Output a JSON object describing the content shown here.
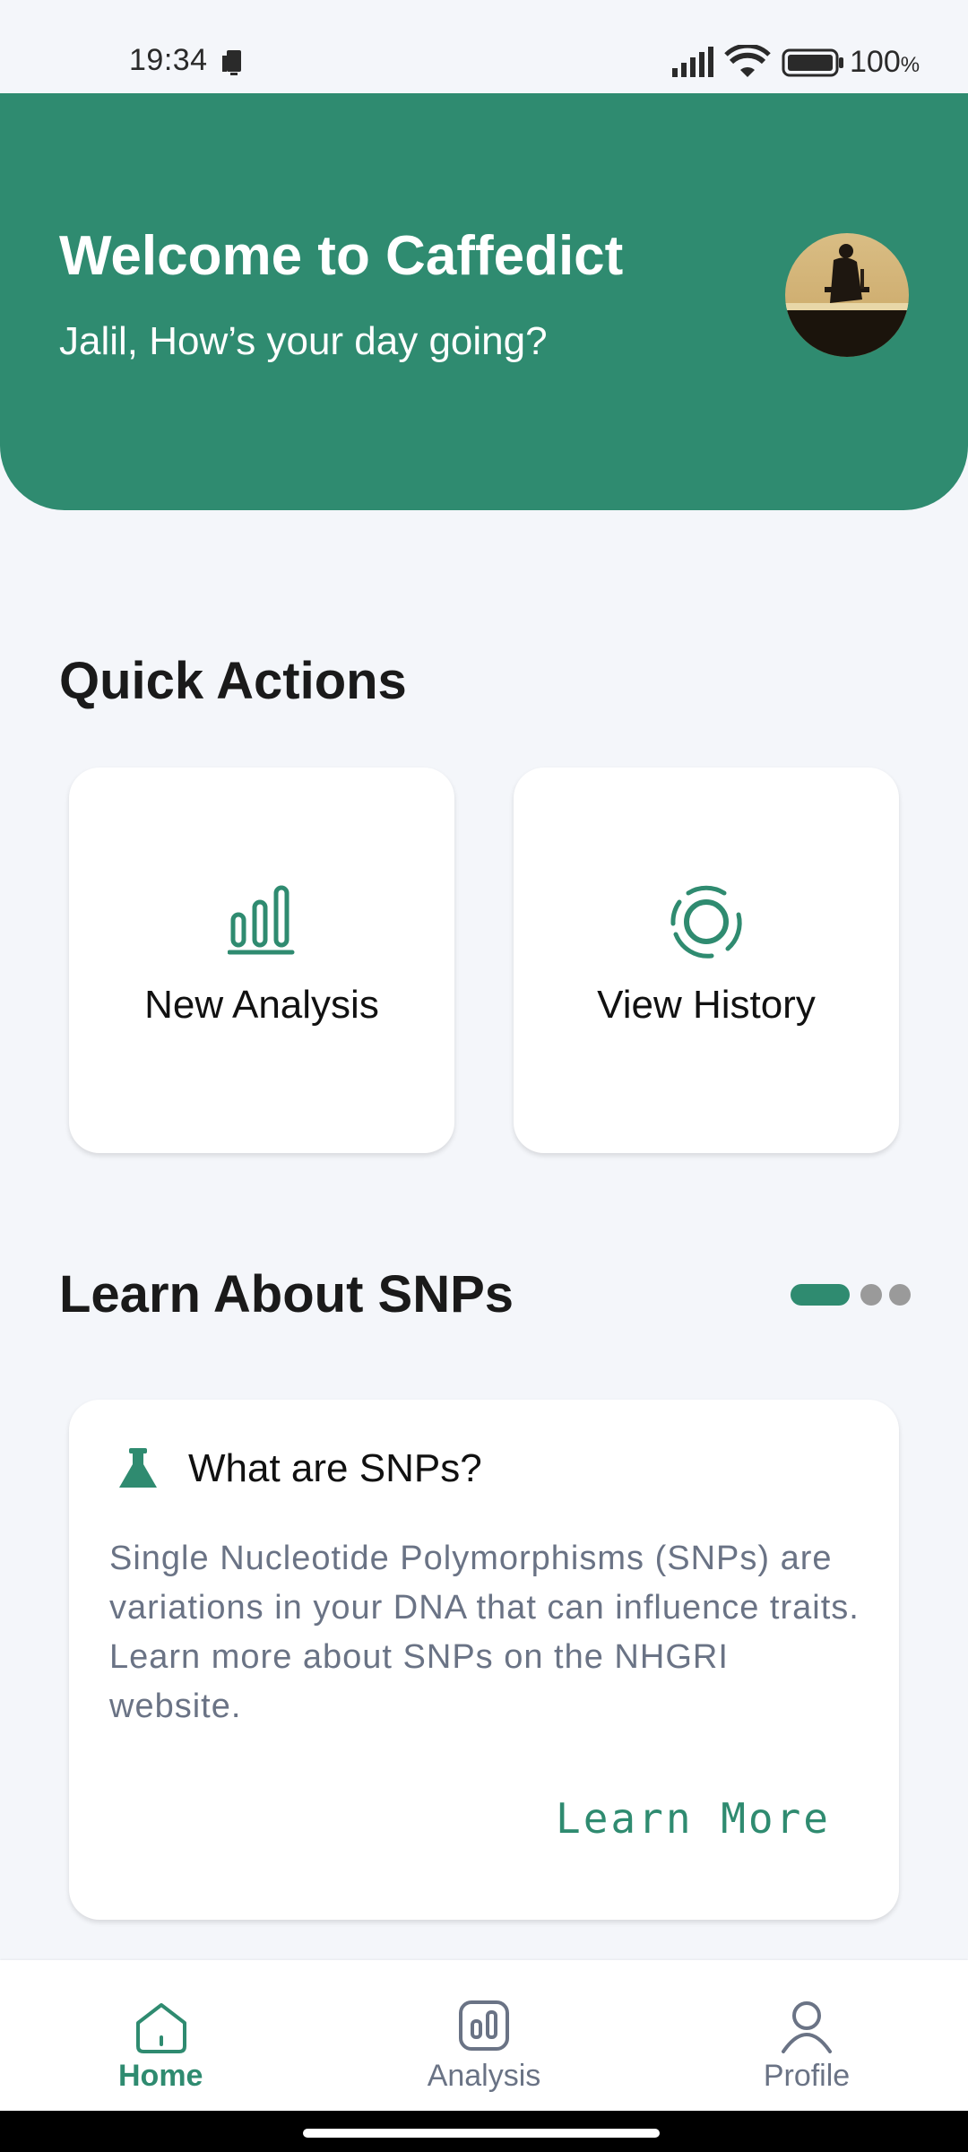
{
  "status_bar": {
    "time": "19:34",
    "battery": "100",
    "battery_unit": "%"
  },
  "header": {
    "title": "Welcome to Caffedict",
    "subtitle": "Jalil, How’s your day going?",
    "accent_color": "#2f8b70"
  },
  "quick_actions": {
    "title": "Quick Actions",
    "items": [
      {
        "label": "New Analysis",
        "icon": "bar-chart-icon"
      },
      {
        "label": "View History",
        "icon": "history-ring-icon"
      }
    ]
  },
  "learn": {
    "title": "Learn About SNPs",
    "pager": {
      "count": 3,
      "active_index": 0
    },
    "card": {
      "icon": "flask-icon",
      "title": "What are SNPs?",
      "body": "Single Nucleotide Polymorphisms (SNPs) are variations in your DNA that can influence traits. Learn more about SNPs on the NHGRI website.",
      "link_label": "Learn More"
    }
  },
  "bottom_nav": {
    "items": [
      {
        "label": "Home",
        "icon": "home-icon",
        "active": true
      },
      {
        "label": "Analysis",
        "icon": "analysis-icon",
        "active": false
      },
      {
        "label": "Profile",
        "icon": "profile-icon",
        "active": false
      }
    ]
  }
}
